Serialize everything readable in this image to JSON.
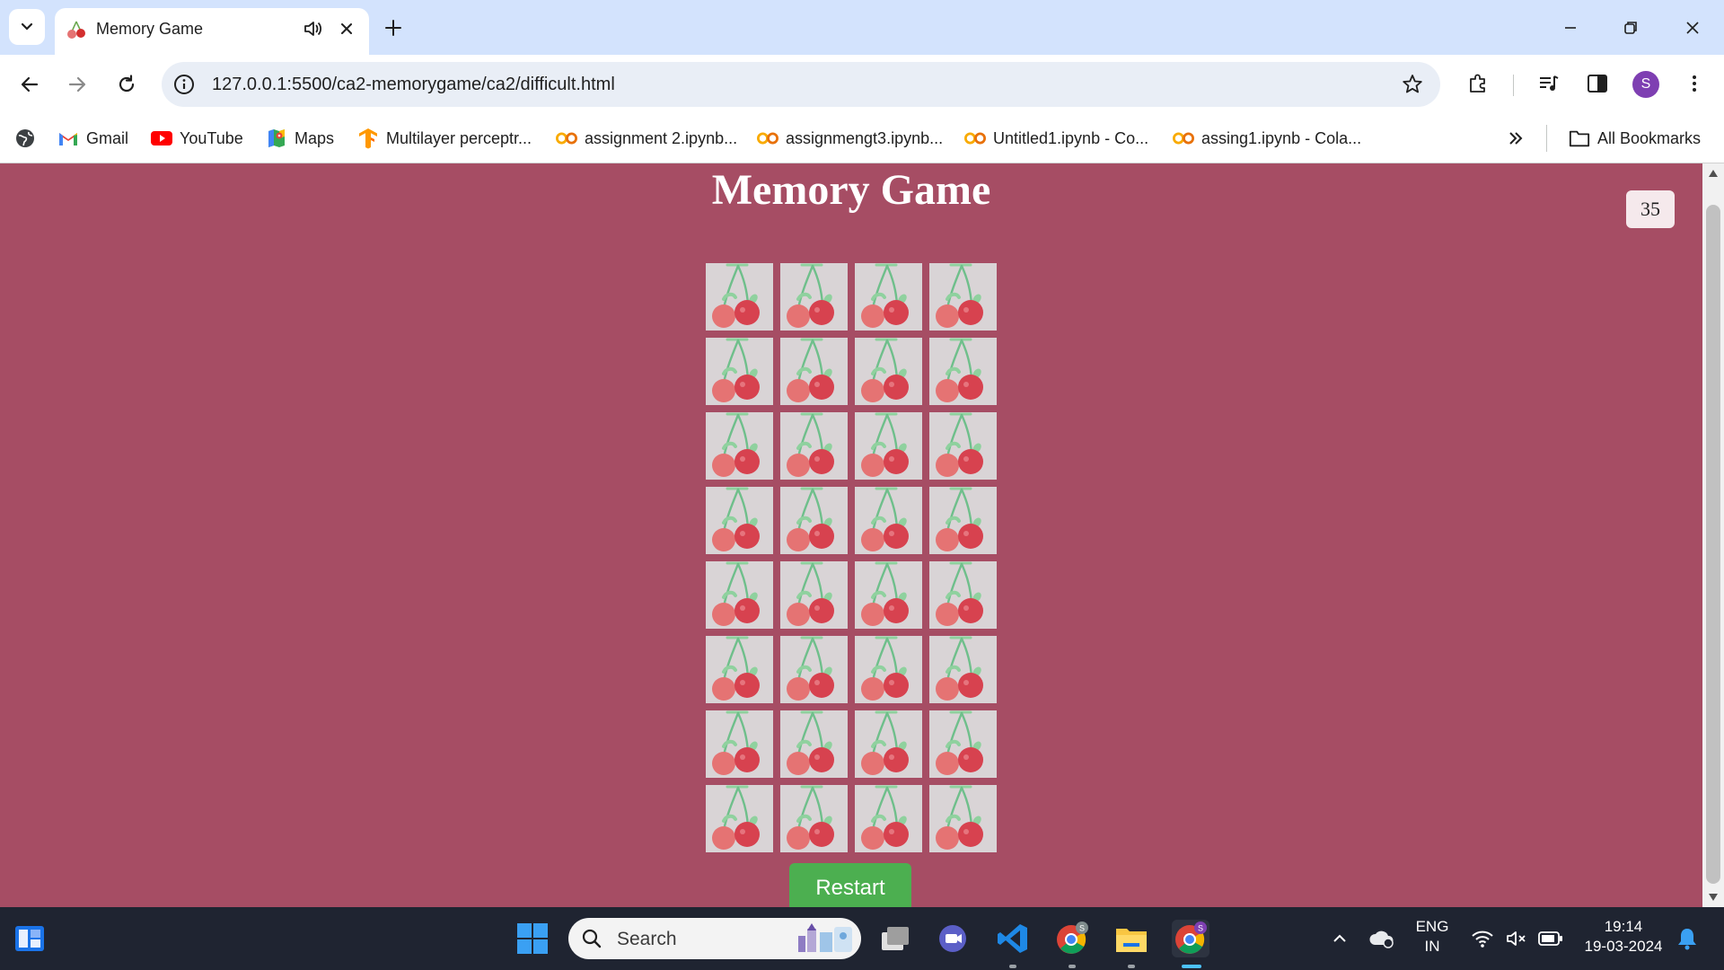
{
  "browser": {
    "tab": {
      "title": "Memory Game"
    },
    "url": "127.0.0.1:5500/ca2-memorygame/ca2/difficult.html",
    "profile_initial": "S",
    "bookmarks": [
      {
        "label": "Gmail",
        "icon": "gmail-icon"
      },
      {
        "label": "YouTube",
        "icon": "youtube-icon"
      },
      {
        "label": "Maps",
        "icon": "maps-icon"
      },
      {
        "label": "Multilayer perceptr...",
        "icon": "tensorflow-icon"
      },
      {
        "label": "assignment 2.ipynb...",
        "icon": "colab-icon"
      },
      {
        "label": "assignmengt3.ipynb...",
        "icon": "colab-icon"
      },
      {
        "label": "Untitled1.ipynb - Co...",
        "icon": "colab-icon"
      },
      {
        "label": "assing1.ipynb - Cola...",
        "icon": "colab-icon"
      }
    ],
    "all_bookmarks_label": "All Bookmarks"
  },
  "game": {
    "title": "Memory Game",
    "counter": "35",
    "card_count": 32,
    "card_back": "cherry-icon",
    "restart_label": "Restart"
  },
  "colors": {
    "page_background": "#a64d64",
    "card_background": "#d9d4d6",
    "restart_button": "#4caf50"
  },
  "taskbar": {
    "search_placeholder": "Search",
    "language_top": "ENG",
    "language_bottom": "IN",
    "time": "19:14",
    "date": "19-03-2024"
  }
}
